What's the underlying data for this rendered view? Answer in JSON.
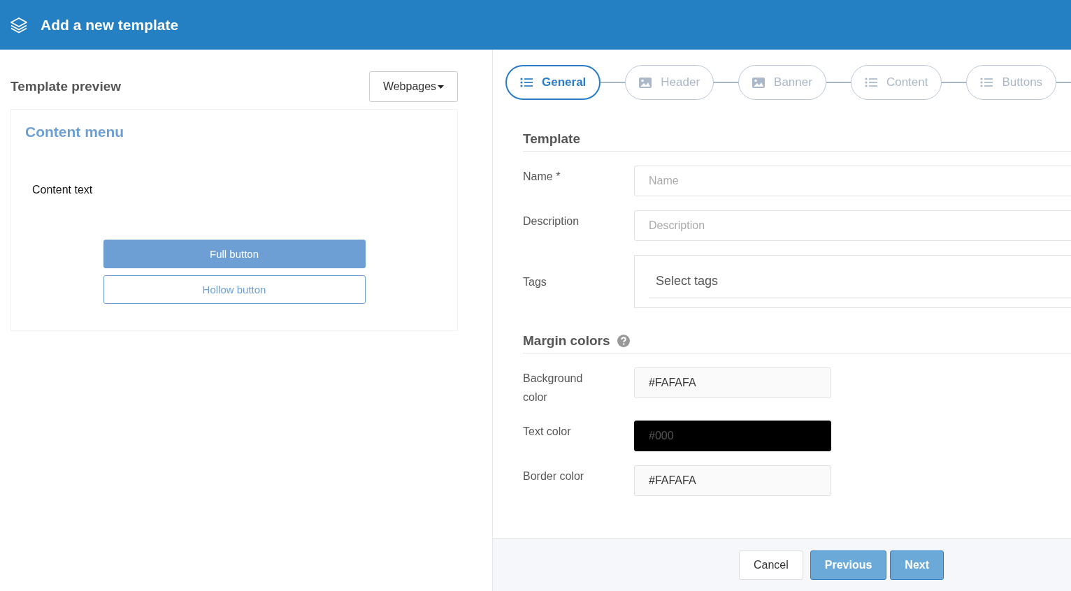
{
  "header": {
    "title": "Add a new template"
  },
  "preview": {
    "title": "Template preview",
    "dropdown": "Webpages",
    "menu_title": "Content menu",
    "content_text": "Content text",
    "buttons": [
      {
        "kind": "full",
        "label": "Full button"
      },
      {
        "kind": "hollow",
        "label": "Hollow button"
      }
    ]
  },
  "steps": [
    {
      "label": "General",
      "kind": "list",
      "selected": true
    },
    {
      "label": "Header",
      "kind": "image",
      "selected": false
    },
    {
      "label": "Banner",
      "kind": "image",
      "selected": false
    },
    {
      "label": "Content",
      "kind": "list",
      "selected": false
    },
    {
      "label": "Buttons",
      "kind": "list",
      "selected": false
    }
  ],
  "sections": [
    {
      "title": "Template",
      "help": false,
      "fields": [
        {
          "kind": "text",
          "label": "Name *",
          "placeholder": "Name"
        },
        {
          "kind": "text",
          "label": "Description",
          "placeholder": "Description"
        },
        {
          "kind": "tags",
          "label": "Tags",
          "placeholder": "Select tags"
        }
      ]
    },
    {
      "title": "Margin colors",
      "help": true,
      "fields": [
        {
          "kind": "color",
          "label": "Background color",
          "value": "#FAFAFA",
          "color": "#fafafa"
        },
        {
          "kind": "color",
          "label": "Text color",
          "value": "#000",
          "color": "#000000"
        },
        {
          "kind": "color",
          "label": "Border color",
          "value": "#FAFAFA",
          "color": "#fafafa"
        }
      ]
    }
  ],
  "footer": {
    "buttons": [
      {
        "kind": "cancel",
        "label": "Cancel"
      },
      {
        "kind": "primary",
        "label": "Previous"
      },
      {
        "kind": "primary",
        "label": "Next"
      }
    ]
  }
}
